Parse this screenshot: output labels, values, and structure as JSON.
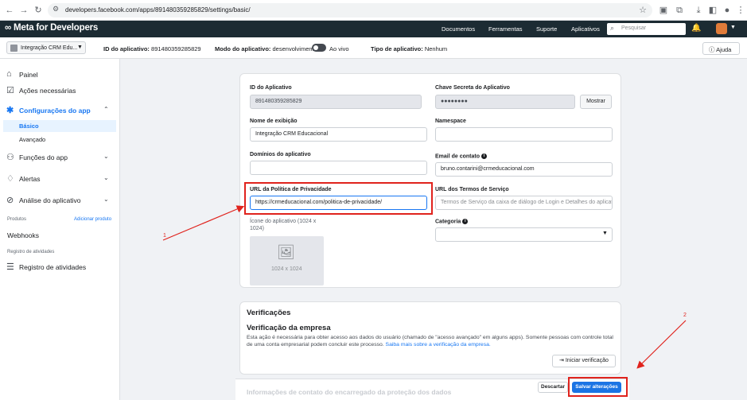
{
  "browser": {
    "url": "developers.facebook.com/apps/891480359285829/settings/basic/"
  },
  "topnav": {
    "logo": "∞ Meta for Developers",
    "links": [
      "Documentos",
      "Ferramentas",
      "Suporte",
      "Aplicativos"
    ],
    "search_placeholder": "Pesquisar"
  },
  "subheader": {
    "app_name": "Integração CRM Edu...",
    "app_id_label": "ID do aplicativo:",
    "app_id_value": "891480359285829",
    "mode_label": "Modo do aplicativo:",
    "mode_value": "desenvolvimento",
    "live_label": "Ao vivo",
    "type_label": "Tipo de aplicativo:",
    "type_value": "Nenhum",
    "help_label": "Ajuda"
  },
  "sidebar": {
    "items": [
      {
        "label": "Painel",
        "icon": "home-icon"
      },
      {
        "label": "Ações necessárias",
        "icon": "checklist-icon"
      },
      {
        "label": "Configurações do app",
        "icon": "gear-icon"
      },
      {
        "label": "Funções do app",
        "icon": "users-icon"
      },
      {
        "label": "Alertas",
        "icon": "bell-icon"
      },
      {
        "label": "Análise do aplicativo",
        "icon": "check-circle-icon"
      }
    ],
    "sub_basic": "Básico",
    "sub_advanced": "Avançado",
    "products_label": "Produtos",
    "add_product": "Adicionar produto",
    "webhooks": "Webhooks",
    "activity_section": "Registro de atividades",
    "activity_item": "Registro de atividades"
  },
  "form": {
    "app_id_label": "ID do Aplicativo",
    "app_id_value": "891480359285829",
    "secret_label": "Chave Secreta do Aplicativo",
    "secret_value": "●●●●●●●●",
    "show_button": "Mostrar",
    "display_name_label": "Nome de exibição",
    "display_name_value": "Integração CRM Educacional",
    "namespace_label": "Namespace",
    "namespace_value": "",
    "domains_label": "Domínios do aplicativo",
    "domains_value": "",
    "email_label": "Email de contato",
    "email_value": "bruno.contarini@crmeducacional.com",
    "privacy_label": "URL da Política de Privacidade",
    "privacy_value": "https://crmeducacional.com/politica-de-privacidade/",
    "tos_label": "URL dos Termos de Serviço",
    "tos_placeholder": "Termos de Serviço da caixa de diálogo de Login e Detalhes do aplicativo",
    "icon_label": "Ícone do aplicativo (1024 x 1024)",
    "icon_size": "1024 x 1024",
    "category_label": "Categoria",
    "category_value": ""
  },
  "verification": {
    "title": "Verificações",
    "subtitle": "Verificação da empresa",
    "text": "Esta ação é necessária para obter acesso aos dados do usuário (chamado de \"acesso avançado\" em alguns apps). Somente pessoas com controle total de uma conta empresarial podem concluir este processo.",
    "link": "Saiba mais sobre a verificação da empresa.",
    "start_button": "Iniciar verificação"
  },
  "footer": {
    "faded_text": "Informações de contato do encarregado da proteção dos dados",
    "discard": "Descartar",
    "save": "Salvar alterações"
  },
  "annotations": {
    "num1": "1",
    "num2": "2",
    "color": "#e0231d"
  }
}
